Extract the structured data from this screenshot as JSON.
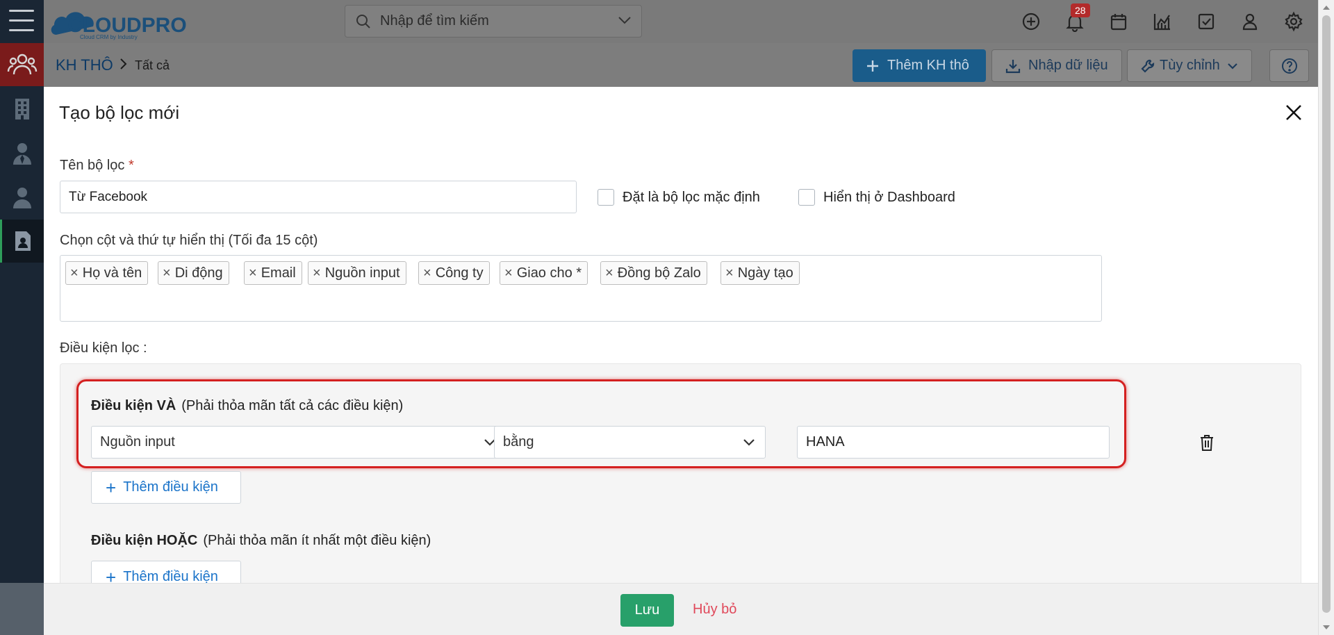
{
  "brand": {
    "logo_text": "CLOUDPRO",
    "logo_tagline": "Cloud CRM by Industry",
    "accent": "#1a5c8a"
  },
  "search": {
    "placeholder": "Nhập để tìm kiếm"
  },
  "topbar": {
    "notification_count": "28",
    "icons": [
      "plus-circle-icon",
      "bell-icon",
      "calendar-icon",
      "chart-icon",
      "task-check-icon",
      "user-icon",
      "gear-icon"
    ]
  },
  "breadcrumb": {
    "module": "KH THÔ",
    "view": "Tất cả"
  },
  "toolbar": {
    "add_label": "Thêm KH thô",
    "import_label": "Nhập dữ liệu",
    "custom_label": "Tùy chỉnh"
  },
  "sidebar": {
    "items": [
      "contacts-group-icon",
      "building-icon",
      "person-tie-icon",
      "person-icon",
      "document-person-icon"
    ]
  },
  "modal": {
    "title": "Tạo bộ lọc mới",
    "name_label": "Tên bộ lọc",
    "name_required": "*",
    "name_value": "Từ Facebook",
    "default_filter_label": "Đặt là bộ lọc mặc định",
    "dashboard_label": "Hiển thị ở Dashboard",
    "columns_label": "Chọn cột và thứ tự hiển thị (Tối đa 15 cột)",
    "columns": [
      "Họ và tên",
      "Di động",
      "Email",
      "Nguồn input",
      "Công ty",
      "Giao cho *",
      "Đồng bộ Zalo",
      "Ngày tạo"
    ],
    "conditions_label": "Điều kiện lọc :",
    "and_group": {
      "title": "Điều kiện VÀ",
      "hint": "(Phải thỏa mãn tất cả các điều kiện)",
      "field": "Nguồn input",
      "operator": "bằng",
      "value": "HANA",
      "add_label": "Thêm điều kiện"
    },
    "or_group": {
      "title": "Điều kiện HOẶC",
      "hint": "(Phải thỏa mãn ít nhất một điều kiện)",
      "add_label": "Thêm điều kiện"
    }
  },
  "footer": {
    "save_label": "Lưu",
    "cancel_label": "Hủy bỏ"
  }
}
